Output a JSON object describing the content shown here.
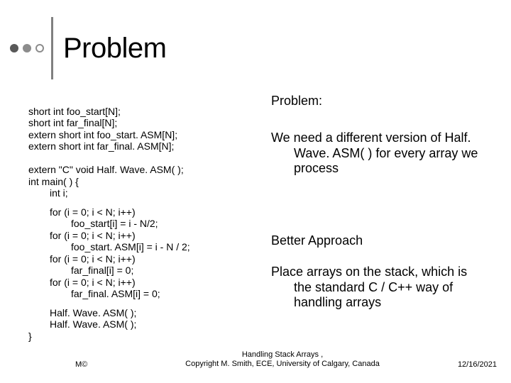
{
  "slide": {
    "title": "Problem"
  },
  "left": {
    "decl1": "short int foo_start[N];",
    "decl2": "short int far_final[N];",
    "decl3": "extern short int foo_start. ASM[N];",
    "decl4": "extern short int far_final. ASM[N];",
    "decl5": "extern \"C\" void Half. Wave. ASM( );",
    "main_open": "int main( ) {",
    "int_i": "int i;",
    "loop1_for": "for (i = 0; i < N; i++)",
    "loop1_body": "foo_start[i] = i - N/2;",
    "loop2_for": "for (i = 0; i < N; i++)",
    "loop2_body": "foo_start. ASM[i] = i - N / 2;",
    "loop3_for": "for (i = 0; i < N; i++)",
    "loop3_body": "far_final[i] = 0;",
    "loop4_for": "for (i = 0; i < N; i++)",
    "loop4_body": "far_final. ASM[i] = 0;",
    "call1": "Half. Wave. ASM( );",
    "call2": "Half. Wave. ASM( );",
    "close": "}"
  },
  "right": {
    "problem_label": "Problem:",
    "problem_text": "We need a different version of Half. Wave. ASM( ) for every array we process",
    "approach_label": "Better Approach",
    "approach_text": "Place arrays on the stack, which is the standard C / C++ way of handling arrays"
  },
  "footer": {
    "left": "M©",
    "center_line1": "Handling Stack Arrays ,",
    "center_line2": "Copyright M. Smith, ECE, University of Calgary, Canada",
    "right": "12/16/2021"
  }
}
